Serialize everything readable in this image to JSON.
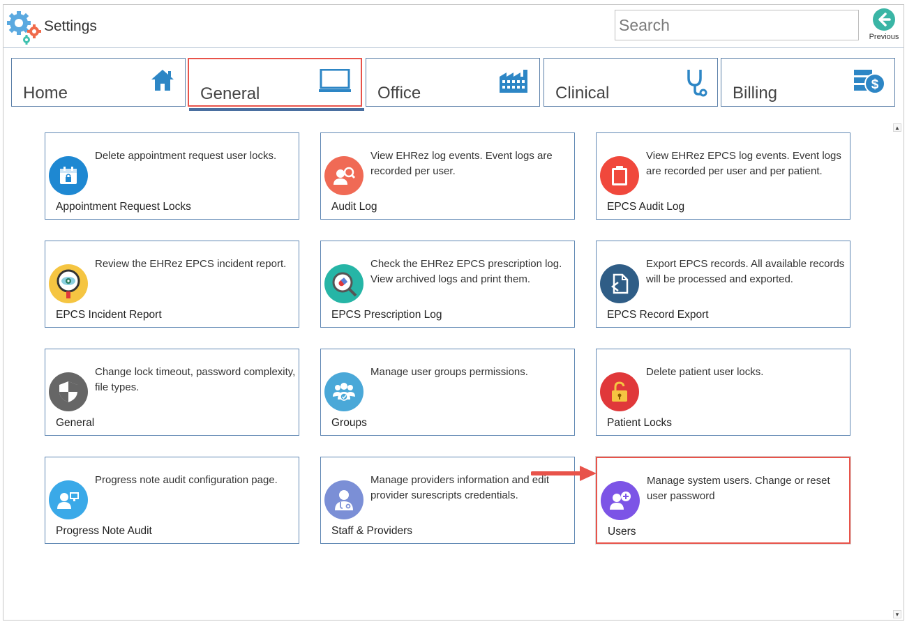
{
  "app": {
    "title": "Settings"
  },
  "search": {
    "placeholder": "Search"
  },
  "previous": {
    "label": "Previous"
  },
  "tabs": [
    {
      "label": "Home",
      "icon": "home-icon",
      "active": false
    },
    {
      "label": "General",
      "icon": "monitor-icon",
      "active": true
    },
    {
      "label": "Office",
      "icon": "factory-icon",
      "active": false
    },
    {
      "label": "Clinical",
      "icon": "stethoscope-icon",
      "active": false
    },
    {
      "label": "Billing",
      "icon": "billing-dollar-icon",
      "active": false
    }
  ],
  "cards": [
    {
      "name": "Appointment Request Locks",
      "description": "Delete appointment request user locks.",
      "icon": "calendar-lock-icon",
      "color": "#1e88d2"
    },
    {
      "name": "Audit Log",
      "description": "View EHRez log events. Event logs are recorded per user.",
      "icon": "user-search-icon",
      "color": "#f06a55"
    },
    {
      "name": "EPCS Audit Log",
      "description": "View EHRez EPCS log events. Event logs are recorded per user and per patient.",
      "icon": "clipboard-icon",
      "color": "#f0483c"
    },
    {
      "name": "EPCS Incident Report",
      "description": "Review the EHRez EPCS incident report.",
      "icon": "magnifier-eye-icon",
      "color": "#f5c542"
    },
    {
      "name": "EPCS Prescription Log",
      "description": "Check the EHRez EPCS prescription log. View archived logs and print them.",
      "icon": "pill-search-icon",
      "color": "#26b5a6"
    },
    {
      "name": "EPCS Record Export",
      "description": "Export EPCS records. All available records will be processed and exported.",
      "icon": "document-export-icon",
      "color": "#2f5d86"
    },
    {
      "name": "General",
      "description": "Change lock timeout, password complexity, file types.",
      "icon": "shield-icon",
      "color": "#666666"
    },
    {
      "name": "Groups",
      "description": "Manage user groups permissions.",
      "icon": "user-group-icon",
      "color": "#4aa8d8"
    },
    {
      "name": "Patient Locks",
      "description": "Delete patient user locks.",
      "icon": "unlocked-padlock-icon",
      "color": "#e0383a"
    },
    {
      "name": "Progress Note Audit",
      "description": "Progress note audit configuration page.",
      "icon": "user-monitor-icon",
      "color": "#3aa9e8"
    },
    {
      "name": "Staff & Providers",
      "description": "Manage providers information and edit provider surescripts credentials.",
      "icon": "doctor-icon",
      "color": "#7b8fd6"
    },
    {
      "name": "Users",
      "description": "Manage system users. Change or reset user password",
      "icon": "user-add-icon",
      "color": "#7c54e6",
      "highlighted": true
    }
  ],
  "colors": {
    "accent_red": "#e8534a",
    "tab_border": "#5a7fa8",
    "card_border": "#5f87b3",
    "tab_underline": "#4a6fa0"
  }
}
